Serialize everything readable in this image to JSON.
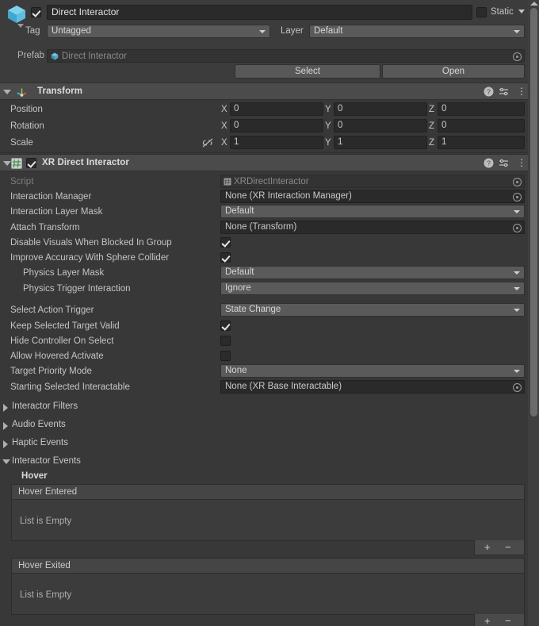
{
  "gameobject": {
    "icon": "cube-icon",
    "enabled": true,
    "name": "Direct Interactor",
    "static_label": "Static",
    "static_checked": false,
    "tag_label": "Tag",
    "tag_value": "Untagged",
    "layer_label": "Layer",
    "layer_value": "Default",
    "prefab_label": "Prefab",
    "prefab_value": "Direct Interactor",
    "select_button": "Select",
    "open_button": "Open"
  },
  "transform": {
    "title": "Transform",
    "expanded": true,
    "rows": [
      {
        "label": "Position",
        "x": "0",
        "y": "0",
        "z": "0"
      },
      {
        "label": "Rotation",
        "x": "0",
        "y": "0",
        "z": "0"
      },
      {
        "label": "Scale",
        "x": "1",
        "y": "1",
        "z": "1"
      }
    ],
    "axis_labels": {
      "x": "X",
      "y": "Y",
      "z": "Z"
    },
    "constrain_icon": "constrain-proportions-off-icon"
  },
  "xr_direct_interactor": {
    "title": "XR Direct Interactor",
    "enabled": true,
    "expanded": true,
    "icon": "script-icon",
    "properties": [
      {
        "label": "Script",
        "type": "object",
        "value": "XRDirectInteractor",
        "dim": true,
        "indent": 0
      },
      {
        "label": "Interaction Manager",
        "type": "object",
        "value": "None (XR Interaction Manager)",
        "indent": 0
      },
      {
        "label": "Interaction Layer Mask",
        "type": "popup",
        "value": "Default",
        "indent": 0
      },
      {
        "label": "Attach Transform",
        "type": "object",
        "value": "None (Transform)",
        "indent": 0
      },
      {
        "label": "Disable Visuals When Blocked In Group",
        "type": "toggle",
        "value": true,
        "indent": 0
      },
      {
        "label": "Improve Accuracy With Sphere Collider",
        "type": "toggle",
        "value": true,
        "indent": 0
      },
      {
        "label": "Physics Layer Mask",
        "type": "popup",
        "value": "Default",
        "indent": 1
      },
      {
        "label": "Physics Trigger Interaction",
        "type": "popup",
        "value": "Ignore",
        "indent": 1
      },
      {
        "label": "Select Action Trigger",
        "type": "popup",
        "value": "State Change",
        "indent": 0,
        "gap": true
      },
      {
        "label": "Keep Selected Target Valid",
        "type": "toggle",
        "value": true,
        "indent": 0
      },
      {
        "label": "Hide Controller On Select",
        "type": "toggle",
        "value": false,
        "indent": 0
      },
      {
        "label": "Allow Hovered Activate",
        "type": "toggle",
        "value": false,
        "indent": 0
      },
      {
        "label": "Target Priority Mode",
        "type": "popup",
        "value": "None",
        "indent": 0
      },
      {
        "label": "Starting Selected Interactable",
        "type": "object",
        "value": "None (XR Base Interactable)",
        "indent": 0
      }
    ],
    "foldouts": [
      {
        "label": "Interactor Filters",
        "expanded": false
      },
      {
        "label": "Audio Events",
        "expanded": false
      },
      {
        "label": "Haptic Events",
        "expanded": false
      },
      {
        "label": "Interactor Events",
        "expanded": true
      }
    ],
    "events_group_label": "Hover",
    "event_lists": [
      {
        "header": "Hover Entered",
        "empty_text": "List is Empty",
        "add": "+",
        "remove": "−"
      },
      {
        "header": "Hover Exited",
        "empty_text": "List is Empty",
        "add": "+",
        "remove": "−"
      }
    ]
  },
  "header_icons": {
    "help": "help-icon",
    "preset": "preset-icon",
    "menu": "kebab-menu-icon"
  },
  "colors": {
    "background": "#383838",
    "header": "#4b4b4b",
    "accent": "#4fc3e8",
    "script_green": "#5ec16a"
  }
}
